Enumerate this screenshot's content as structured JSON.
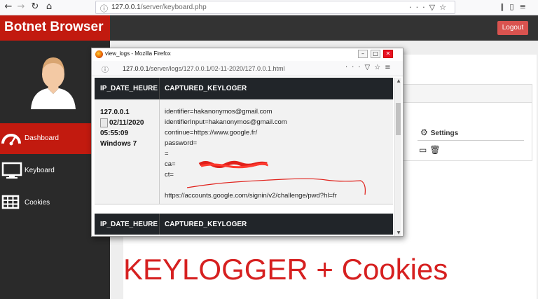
{
  "browser": {
    "url_host": "127.0.0.1",
    "url_path": "/server/keyboard.php"
  },
  "app": {
    "brand": "Botnet Browser",
    "logout_label": "Logout",
    "sidebar": {
      "items": [
        {
          "label": "Dashboard",
          "icon": "speedometer-icon",
          "active": true
        },
        {
          "label": "Keyboard",
          "icon": "monitor-icon",
          "active": false
        },
        {
          "label": "Cookies",
          "icon": "grid-icon",
          "active": false
        }
      ]
    },
    "panel": {
      "settings_label": "Settings"
    },
    "overlay_title": "KEYLOGGER + Cookies"
  },
  "popup": {
    "window_title": "view_logs - Mozilla Firefox",
    "url_host": "127.0.0.1",
    "url_path": "/server/logs/127.0.0.1/02-11-2020/127.0.0.1.html",
    "table": {
      "headers": [
        "IP_DATE_HEURE",
        "CAPTURED_KEYLOGER"
      ],
      "row": {
        "ip": "127.0.0.1",
        "date": "02/11/2020",
        "time": "05:55:09",
        "os": "Windows 7",
        "log_lines": [
          "identifier=hakanonymos@gmail.com",
          "identifierInput=hakanonymos@gmail.com",
          "continue=https://www.google.fr/",
          "password=",
          "=",
          "ca=",
          "ct=",
          "",
          "https://accounts.google.com/signin/v2/challenge/pwd?hl=fr"
        ]
      }
    }
  },
  "colors": {
    "brand_red": "#c21a0f",
    "topbar": "#333333",
    "sidebar": "#2a2a2a",
    "table_header": "#212529",
    "overlay_text": "#d62020"
  }
}
